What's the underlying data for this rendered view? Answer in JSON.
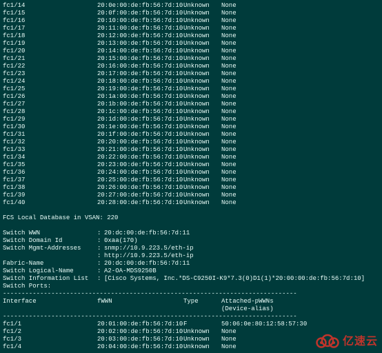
{
  "vsan": "220",
  "fcs_heading": "FCS Local Database in VSAN: 220",
  "topRows": [
    {
      "interface": "fc1/14",
      "fwwn": "20:0e:00:de:fb:56:7d:10",
      "type": "Unknown",
      "attached": "None"
    },
    {
      "interface": "fc1/15",
      "fwwn": "20:0f:00:de:fb:56:7d:10",
      "type": "Unknown",
      "attached": "None"
    },
    {
      "interface": "fc1/16",
      "fwwn": "20:10:00:de:fb:56:7d:10",
      "type": "Unknown",
      "attached": "None"
    },
    {
      "interface": "fc1/17",
      "fwwn": "20:11:00:de:fb:56:7d:10",
      "type": "Unknown",
      "attached": "None"
    },
    {
      "interface": "fc1/18",
      "fwwn": "20:12:00:de:fb:56:7d:10",
      "type": "Unknown",
      "attached": "None"
    },
    {
      "interface": "fc1/19",
      "fwwn": "20:13:00:de:fb:56:7d:10",
      "type": "Unknown",
      "attached": "None"
    },
    {
      "interface": "fc1/20",
      "fwwn": "20:14:00:de:fb:56:7d:10",
      "type": "Unknown",
      "attached": "None"
    },
    {
      "interface": "fc1/21",
      "fwwn": "20:15:00:de:fb:56:7d:10",
      "type": "Unknown",
      "attached": "None"
    },
    {
      "interface": "fc1/22",
      "fwwn": "20:16:00:de:fb:56:7d:10",
      "type": "Unknown",
      "attached": "None"
    },
    {
      "interface": "fc1/23",
      "fwwn": "20:17:00:de:fb:56:7d:10",
      "type": "Unknown",
      "attached": "None"
    },
    {
      "interface": "fc1/24",
      "fwwn": "20:18:00:de:fb:56:7d:10",
      "type": "Unknown",
      "attached": "None"
    },
    {
      "interface": "fc1/25",
      "fwwn": "20:19:00:de:fb:56:7d:10",
      "type": "Unknown",
      "attached": "None"
    },
    {
      "interface": "fc1/26",
      "fwwn": "20:1a:00:de:fb:56:7d:10",
      "type": "Unknown",
      "attached": "None"
    },
    {
      "interface": "fc1/27",
      "fwwn": "20:1b:00:de:fb:56:7d:10",
      "type": "Unknown",
      "attached": "None"
    },
    {
      "interface": "fc1/28",
      "fwwn": "20:1c:00:de:fb:56:7d:10",
      "type": "Unknown",
      "attached": "None"
    },
    {
      "interface": "fc1/29",
      "fwwn": "20:1d:00:de:fb:56:7d:10",
      "type": "Unknown",
      "attached": "None"
    },
    {
      "interface": "fc1/30",
      "fwwn": "20:1e:00:de:fb:56:7d:10",
      "type": "Unknown",
      "attached": "None"
    },
    {
      "interface": "fc1/31",
      "fwwn": "20:1f:00:de:fb:56:7d:10",
      "type": "Unknown",
      "attached": "None"
    },
    {
      "interface": "fc1/32",
      "fwwn": "20:20:00:de:fb:56:7d:10",
      "type": "Unknown",
      "attached": "None"
    },
    {
      "interface": "fc1/33",
      "fwwn": "20:21:00:de:fb:56:7d:10",
      "type": "Unknown",
      "attached": "None"
    },
    {
      "interface": "fc1/34",
      "fwwn": "20:22:00:de:fb:56:7d:10",
      "type": "Unknown",
      "attached": "None"
    },
    {
      "interface": "fc1/35",
      "fwwn": "20:23:00:de:fb:56:7d:10",
      "type": "Unknown",
      "attached": "None"
    },
    {
      "interface": "fc1/36",
      "fwwn": "20:24:00:de:fb:56:7d:10",
      "type": "Unknown",
      "attached": "None"
    },
    {
      "interface": "fc1/37",
      "fwwn": "20:25:00:de:fb:56:7d:10",
      "type": "Unknown",
      "attached": "None"
    },
    {
      "interface": "fc1/38",
      "fwwn": "20:26:00:de:fb:56:7d:10",
      "type": "Unknown",
      "attached": "None"
    },
    {
      "interface": "fc1/39",
      "fwwn": "20:27:00:de:fb:56:7d:10",
      "type": "Unknown",
      "attached": "None"
    },
    {
      "interface": "fc1/40",
      "fwwn": "20:28:00:de:fb:56:7d:10",
      "type": "Unknown",
      "attached": "None"
    }
  ],
  "switchInfo": {
    "wwn": {
      "label": "Switch WWN",
      "value": "20:dc:00:de:fb:56:7d:11"
    },
    "domain": {
      "label": "Switch Domain Id",
      "value": "0xaa(170)"
    },
    "mgmt1": {
      "label": "Switch Mgmt-Addresses",
      "value": "snmp://10.9.223.5/eth-ip"
    },
    "mgmt2": {
      "label": "",
      "value": "http://10.9.223.5/eth-ip"
    },
    "fabric": {
      "label": "Fabric-Name",
      "value": "20:dc:00:de:fb:56:7d:11"
    },
    "logical": {
      "label": "Switch Logical-Name",
      "value": "A2-OA-MDS9250B"
    },
    "infoList": {
      "label": "Switch Information List",
      "value": "[Cisco Systems, Inc.*DS-C9250I-K9*7.3(0)D1(1)*20:00:00:de:fb:56:7d:10]"
    },
    "ports": {
      "label": "Switch Ports:",
      "value": ""
    }
  },
  "tableHeader": {
    "interface": "Interface",
    "fwwn": "fWWN",
    "type": "Type",
    "attached": "Attached-pWWNs",
    "attached2": "(Device-alias)"
  },
  "portRows": [
    {
      "interface": "fc1/1",
      "fwwn": "20:01:00:de:fb:56:7d:10",
      "type": "F",
      "attached": "50:06:0e:80:12:58:57:30"
    },
    {
      "interface": "fc1/2",
      "fwwn": "20:02:00:de:fb:56:7d:10",
      "type": "Unknown",
      "attached": "None"
    },
    {
      "interface": "fc1/3",
      "fwwn": "20:03:00:de:fb:56:7d:10",
      "type": "Unknown",
      "attached": "None"
    },
    {
      "interface": "fc1/4",
      "fwwn": "20:04:00:de:fb:56:7d:10",
      "type": "Unknown",
      "attached": "None"
    }
  ],
  "dividerText": "-------------------------------------------------------------------------------",
  "watermark": {
    "text": "亿速云"
  }
}
